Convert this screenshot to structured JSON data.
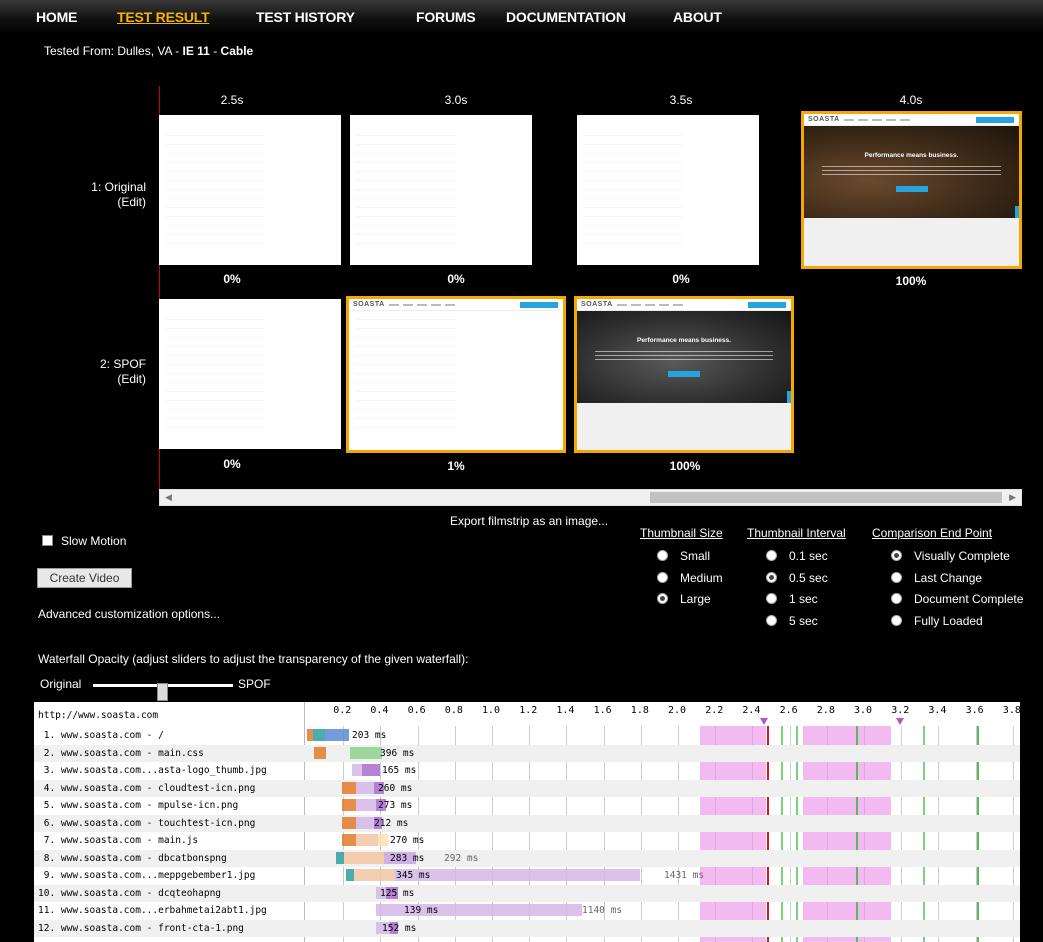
{
  "nav": {
    "items": [
      "HOME",
      "TEST RESULT",
      "TEST HISTORY",
      "FORUMS",
      "DOCUMENTATION",
      "ABOUT"
    ],
    "active": "TEST RESULT"
  },
  "tested_from": {
    "prefix": "Tested From: Dulles, VA - ",
    "browser": "IE 11",
    "sep": " - ",
    "connection": "Cable"
  },
  "filmstrip": {
    "times": [
      "2.5s",
      "3.0s",
      "3.5s",
      "4.0s"
    ],
    "rows": [
      {
        "label": "1: Original",
        "edit": "(Edit)",
        "percents": [
          "0%",
          "0%",
          "0%",
          "100%"
        ]
      },
      {
        "label": "2: SPOF",
        "edit": "(Edit)",
        "percents": [
          "0%",
          "1%",
          "100%"
        ]
      }
    ],
    "thumb_headline": "Performance means business.",
    "thumb_logo": "SOASTA"
  },
  "export_link": "Export filmstrip as an image...",
  "slow_motion": "Slow Motion",
  "create_video": "Create Video",
  "advanced": "Advanced customization options...",
  "options": {
    "thumbnail_size": {
      "title": "Thumbnail Size",
      "items": [
        "Small",
        "Medium",
        "Large"
      ],
      "selected": "Large"
    },
    "thumbnail_interval": {
      "title": "Thumbnail Interval",
      "items": [
        "0.1 sec",
        "0.5 sec",
        "1 sec",
        "5 sec"
      ],
      "selected": "0.5 sec"
    },
    "comparison_end": {
      "title": "Comparison End Point",
      "items": [
        "Visually Complete",
        "Last Change",
        "Document Complete",
        "Fully Loaded"
      ],
      "selected": "Visually Complete"
    }
  },
  "waterfall_opacity": {
    "text": "Waterfall Opacity (adjust sliders to adjust the transparency of the given waterfall):",
    "left_label": "Original",
    "right_label": "SPOF",
    "value": 0.5
  },
  "waterfall": {
    "url": "http://www.soasta.com",
    "ticks": [
      "0.2",
      "0.4",
      "0.6",
      "0.8",
      "1.0",
      "1.2",
      "1.4",
      "1.6",
      "1.8",
      "2.0",
      "2.2",
      "2.4",
      "2.6",
      "2.8",
      "3.0",
      "3.2",
      "3.4",
      "3.6",
      "3.8"
    ],
    "rows": [
      {
        "name": " 1. www.soasta.com - /",
        "time": "203 ms"
      },
      {
        "name": " 2. www.soasta.com - main.css",
        "time": "396 ms"
      },
      {
        "name": " 3. www.soasta.com...asta-logo_thumb.jpg",
        "time": "165 ms"
      },
      {
        "name": " 4. www.soasta.com - cloudtest-icn.png",
        "time": "260 ms"
      },
      {
        "name": " 5. www.soasta.com - mpulse-icn.png",
        "time": "273 ms"
      },
      {
        "name": " 6. www.soasta.com - touchtest-icn.png",
        "time": "212 ms"
      },
      {
        "name": " 7. www.soasta.com - main.js",
        "time": "270 ms"
      },
      {
        "name": " 8. www.soasta.com - dbcatbonspng",
        "time": "283 ms",
        "time2": "292 ms"
      },
      {
        "name": " 9. www.soasta.com...meppgebember1.jpg",
        "time": "345 ms",
        "time2": "1431 ms"
      },
      {
        "name": "10. www.soasta.com - dcqteohapng",
        "time": "125 ms"
      },
      {
        "name": "11. www.soasta.com...erbahmetai2abt1.jpg",
        "time": "139 ms",
        "time2": "1140 ms"
      },
      {
        "name": "12. www.soasta.com - front-cta-1.png",
        "time": "152 ms"
      }
    ]
  }
}
